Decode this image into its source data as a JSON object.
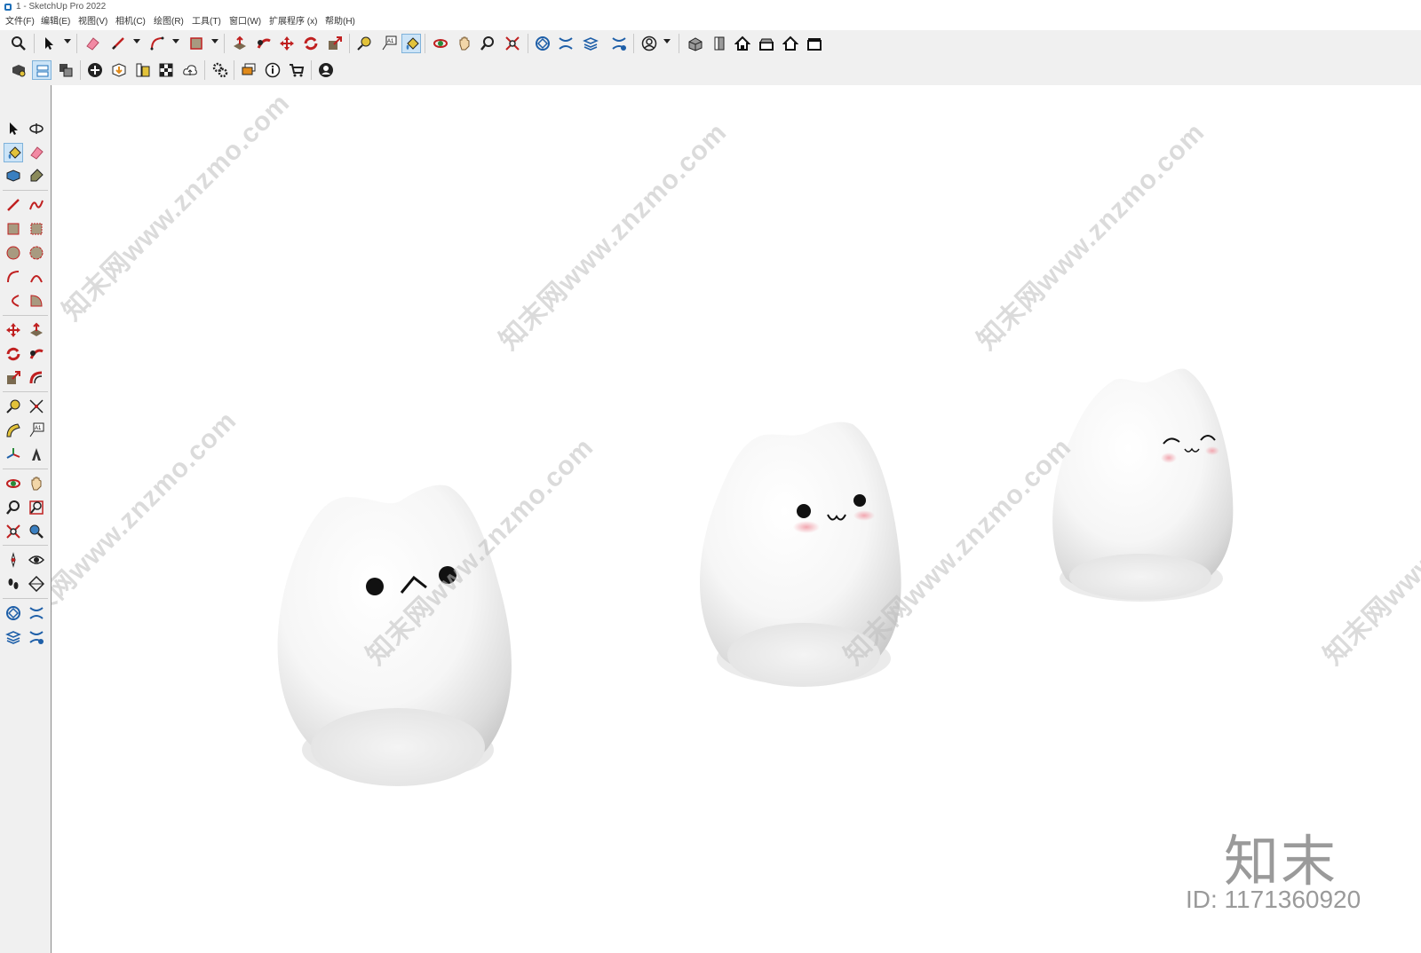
{
  "window": {
    "title": "1 - SketchUp Pro 2022"
  },
  "menu": [
    "文件(F)",
    "编辑(E)",
    "视图(V)",
    "相机(C)",
    "绘图(R)",
    "工具(T)",
    "窗口(W)",
    "扩展程序 (x)",
    "帮助(H)"
  ],
  "toolbar_top": [
    {
      "name": "zoom-icon"
    },
    {
      "name": "select-arrow-icon"
    },
    {
      "name": "eraser-icon"
    },
    {
      "name": "pencil-line-icon"
    },
    {
      "name": "arc-icon"
    },
    {
      "name": "rectangle-icon"
    },
    {
      "name": "push-pull-icon"
    },
    {
      "name": "follow-me-icon"
    },
    {
      "name": "move-icon"
    },
    {
      "name": "rotate-icon"
    },
    {
      "name": "scale-icon"
    },
    {
      "name": "tape-measure-icon"
    },
    {
      "name": "text-label-icon"
    },
    {
      "name": "paint-bucket-icon"
    },
    {
      "name": "orbit-icon"
    },
    {
      "name": "pan-icon"
    },
    {
      "name": "zoom-window-icon"
    },
    {
      "name": "zoom-extents-icon"
    },
    {
      "name": "sandbox-icon"
    },
    {
      "name": "sandbox-stamp-icon"
    },
    {
      "name": "layers-icon"
    },
    {
      "name": "sandbox-flip-icon"
    },
    {
      "name": "user-account-icon"
    },
    {
      "name": "iso-view-icon"
    },
    {
      "name": "front-view-icon"
    },
    {
      "name": "home-view-icon"
    },
    {
      "name": "back-view-icon"
    },
    {
      "name": "house-outline-icon"
    },
    {
      "name": "store-view-icon"
    }
  ],
  "toolbar_second": [
    {
      "name": "components-icon"
    },
    {
      "name": "outliner-icon"
    },
    {
      "name": "scenes-icon"
    },
    {
      "name": "add-location-icon"
    },
    {
      "name": "3d-warehouse-icon"
    },
    {
      "name": "library-icon"
    },
    {
      "name": "checker-icon"
    },
    {
      "name": "cloud-upload-icon"
    },
    {
      "name": "settings-gears-icon"
    },
    {
      "name": "message-icon"
    },
    {
      "name": "info-icon"
    },
    {
      "name": "cart-icon"
    },
    {
      "name": "profile-icon"
    }
  ],
  "watermarks": [
    "知末网www.znzmo.com",
    "知末网www.znzmo.com",
    "知末网www.znzmo.com",
    "知末网www.znzmo.com",
    "知末网www.znzmo.com",
    "知末网www.znzmo.com",
    "知末网www.znzmo.com",
    "知末网www.znzmo.com"
  ],
  "brand": {
    "logo": "知末",
    "id": "ID: 1171360920"
  },
  "colors": {
    "toolbar_bg": "#f0f0f0",
    "active_tool": "#cce4f7",
    "viewport_bg": "#ffffff",
    "cheek": "#f2a7b0"
  }
}
